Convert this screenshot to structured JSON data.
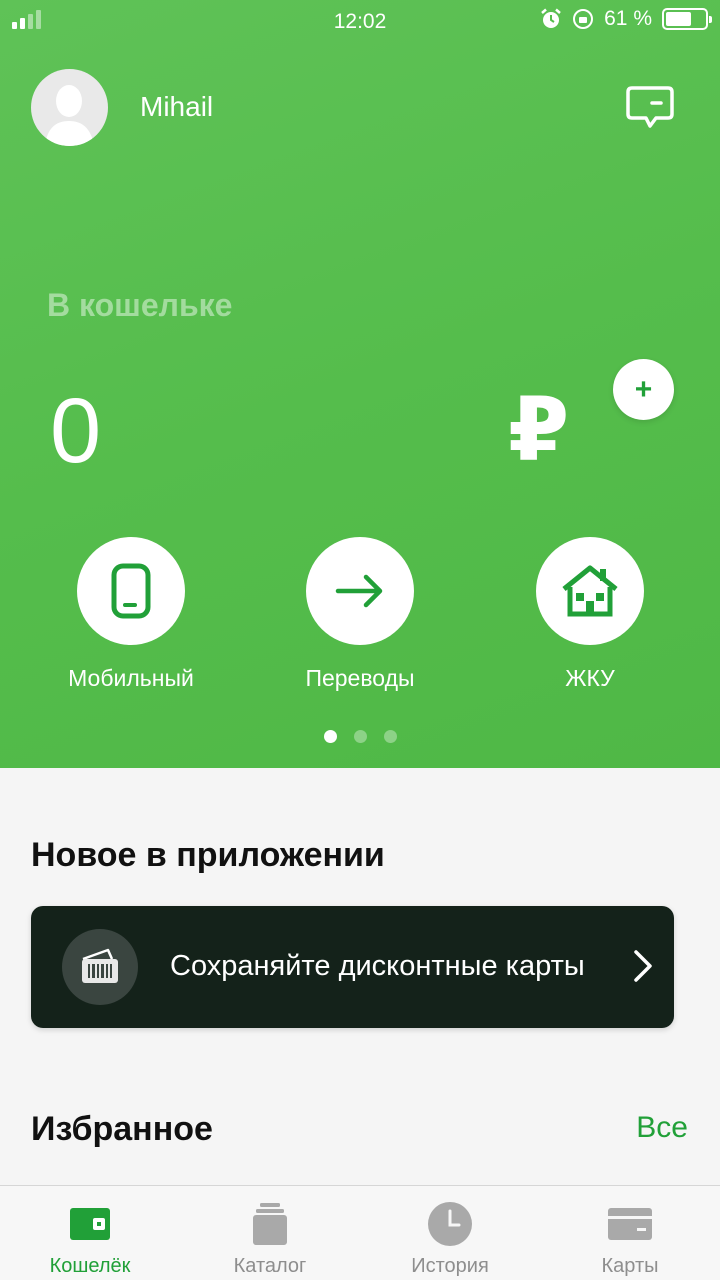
{
  "status_bar": {
    "time": "12:02",
    "battery": "61 %"
  },
  "header": {
    "username": "Mihail"
  },
  "wallet": {
    "label": "В кошельке",
    "balance": "0",
    "currency": "₽",
    "add_symbol": "+"
  },
  "actions": [
    {
      "label": "Мобильный",
      "icon": "mobile-phone-icon"
    },
    {
      "label": "Переводы",
      "icon": "arrow-right-icon"
    },
    {
      "label": "ЖКУ",
      "icon": "house-icon"
    }
  ],
  "pager": {
    "count": 3,
    "active": 0
  },
  "new_section": {
    "title": "Новое в приложении"
  },
  "promo": {
    "text": "Сохраняйте дисконтные карты",
    "icon": "discount-card-icon"
  },
  "favorites": {
    "title": "Избранное",
    "all_label": "Все"
  },
  "tabs": [
    {
      "label": "Кошелёк",
      "icon": "wallet-icon",
      "active": true
    },
    {
      "label": "Каталог",
      "icon": "catalog-icon",
      "active": false
    },
    {
      "label": "История",
      "icon": "clock-icon",
      "active": false
    },
    {
      "label": "Карты",
      "icon": "card-icon",
      "active": false
    }
  ],
  "colors": {
    "brand_green": "#21a038",
    "hero_green": "#55bd4c",
    "promo_bg": "#14221a"
  }
}
